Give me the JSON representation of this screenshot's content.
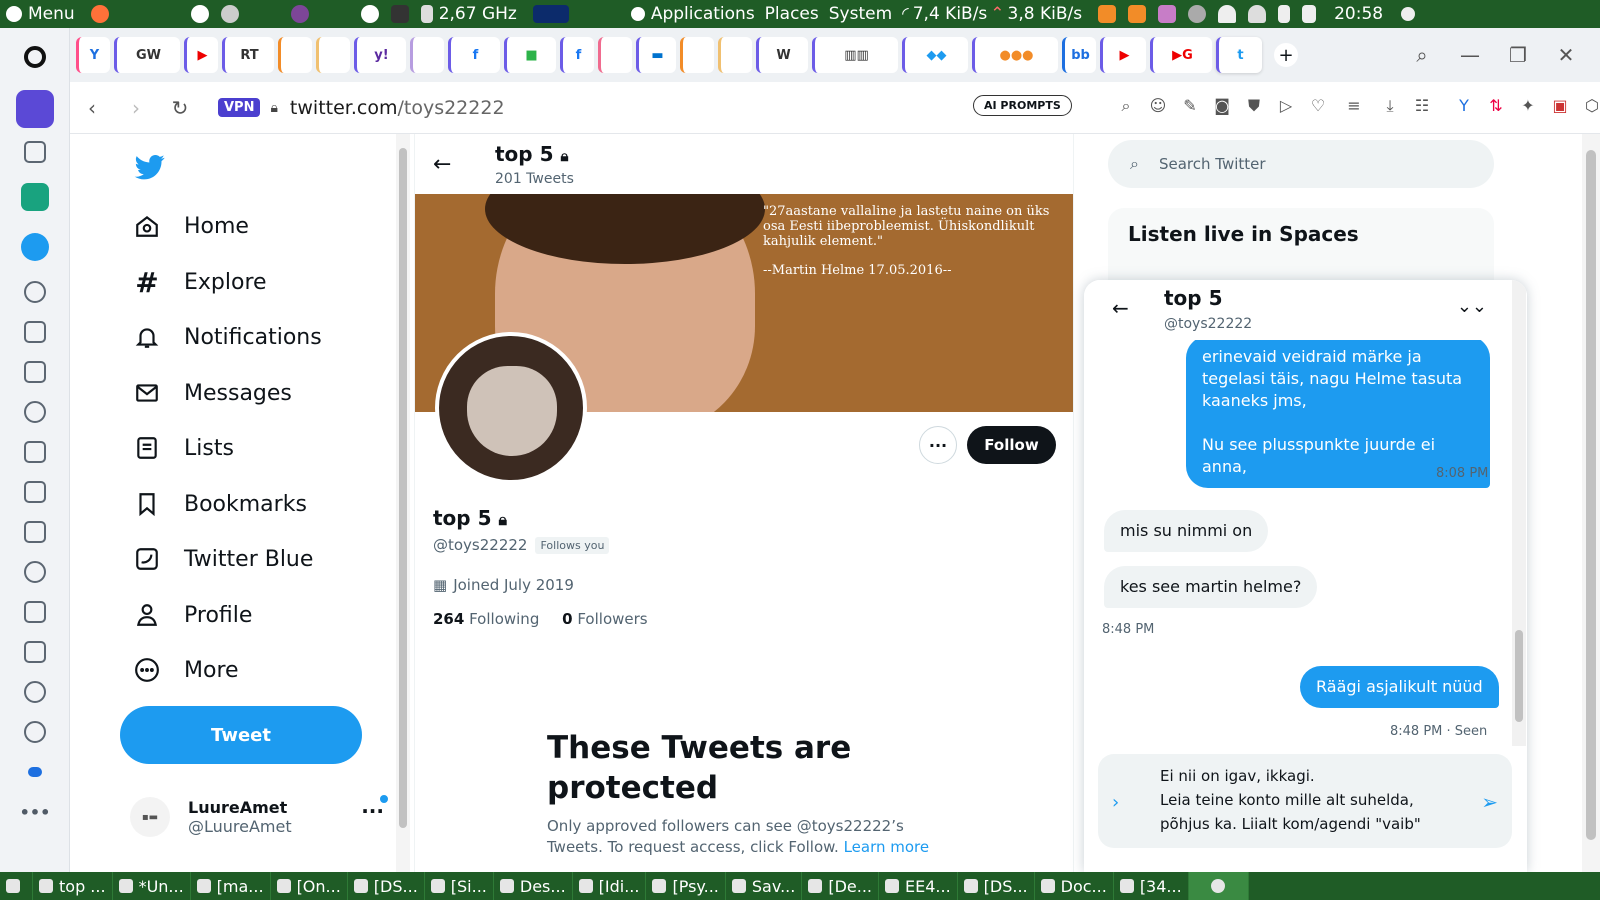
{
  "system_bar": {
    "menu": "Menu",
    "cpu": "2,67 GHz",
    "applications": "Applications",
    "places": "Places",
    "system": "System",
    "net_down": "7,4 KiB/s",
    "net_up": "3,8 KiB/s",
    "time": "20:58"
  },
  "browser": {
    "vpn": "VPN",
    "url_host": "twitter.com",
    "url_path": "/toys22222",
    "ai_prompts": "AI PROMPTS"
  },
  "nav": {
    "items": [
      {
        "label": "Home"
      },
      {
        "label": "Explore"
      },
      {
        "label": "Notifications"
      },
      {
        "label": "Messages"
      },
      {
        "label": "Lists"
      },
      {
        "label": "Bookmarks"
      },
      {
        "label": "Twitter Blue"
      },
      {
        "label": "Profile"
      },
      {
        "label": "More"
      }
    ],
    "tweet_button": "Tweet",
    "account": {
      "name": "LuureAmet",
      "handle": "@LuureAmet"
    }
  },
  "profile": {
    "header_title": "top 5",
    "tweet_count": "201 Tweets",
    "banner_quote": "\"27aastane vallaline ja lastetu naine on üks osa Eesti iibeprobleemist. Ühiskondlikult kahjulik element.\"",
    "banner_author": "--Martin Helme 17.05.2016--",
    "name": "top 5",
    "handle": "@toys22222",
    "follows_you": "Follows you",
    "joined": "Joined July 2019",
    "following_count": "264",
    "following_label": "Following",
    "followers_count": "0",
    "followers_label": "Followers",
    "follow_button": "Follow",
    "protected_title": "These Tweets are protected",
    "protected_body": "Only approved followers can see @toys22222’s Tweets. To request access, click Follow.",
    "learn_more": "Learn more"
  },
  "sidebar": {
    "search_placeholder": "Search Twitter",
    "spaces_title": "Listen live in Spaces"
  },
  "dm": {
    "title": "top 5",
    "handle": "@toys22222",
    "messages": [
      {
        "text": "erinevaid veidraid märke ja tegelasi täis, nagu Helme tasuta kaaneks jms,\n\nNu see plusspunkte juurde ei anna,"
      },
      {
        "text": "mis su nimmi on"
      },
      {
        "text": "kes see martin helme?"
      },
      {
        "text": "Räägi asjalikult nüüd"
      }
    ],
    "timestamps": [
      "8:08 PM",
      "8:48 PM",
      "8:48 PM · Seen"
    ],
    "draft": "Ei nii on igav,  ikkagi.\nLeia teine konto mille alt suhelda, põhjus ka.  Liialt kom/agendi \"vaib\""
  },
  "taskbar": {
    "items": [
      "top ...",
      "*Un...",
      "[ma...",
      "[On...",
      "[DS...",
      "[Si...",
      "Des...",
      "[Idi...",
      "[Psy...",
      "Sav...",
      "[De...",
      "EE4...",
      "[DS...",
      "Doc...",
      "[34..."
    ]
  },
  "colors": {
    "twitter_blue": "#1d9bf0",
    "system_bar": "#1f5c26",
    "follow_black": "#0f1419"
  }
}
